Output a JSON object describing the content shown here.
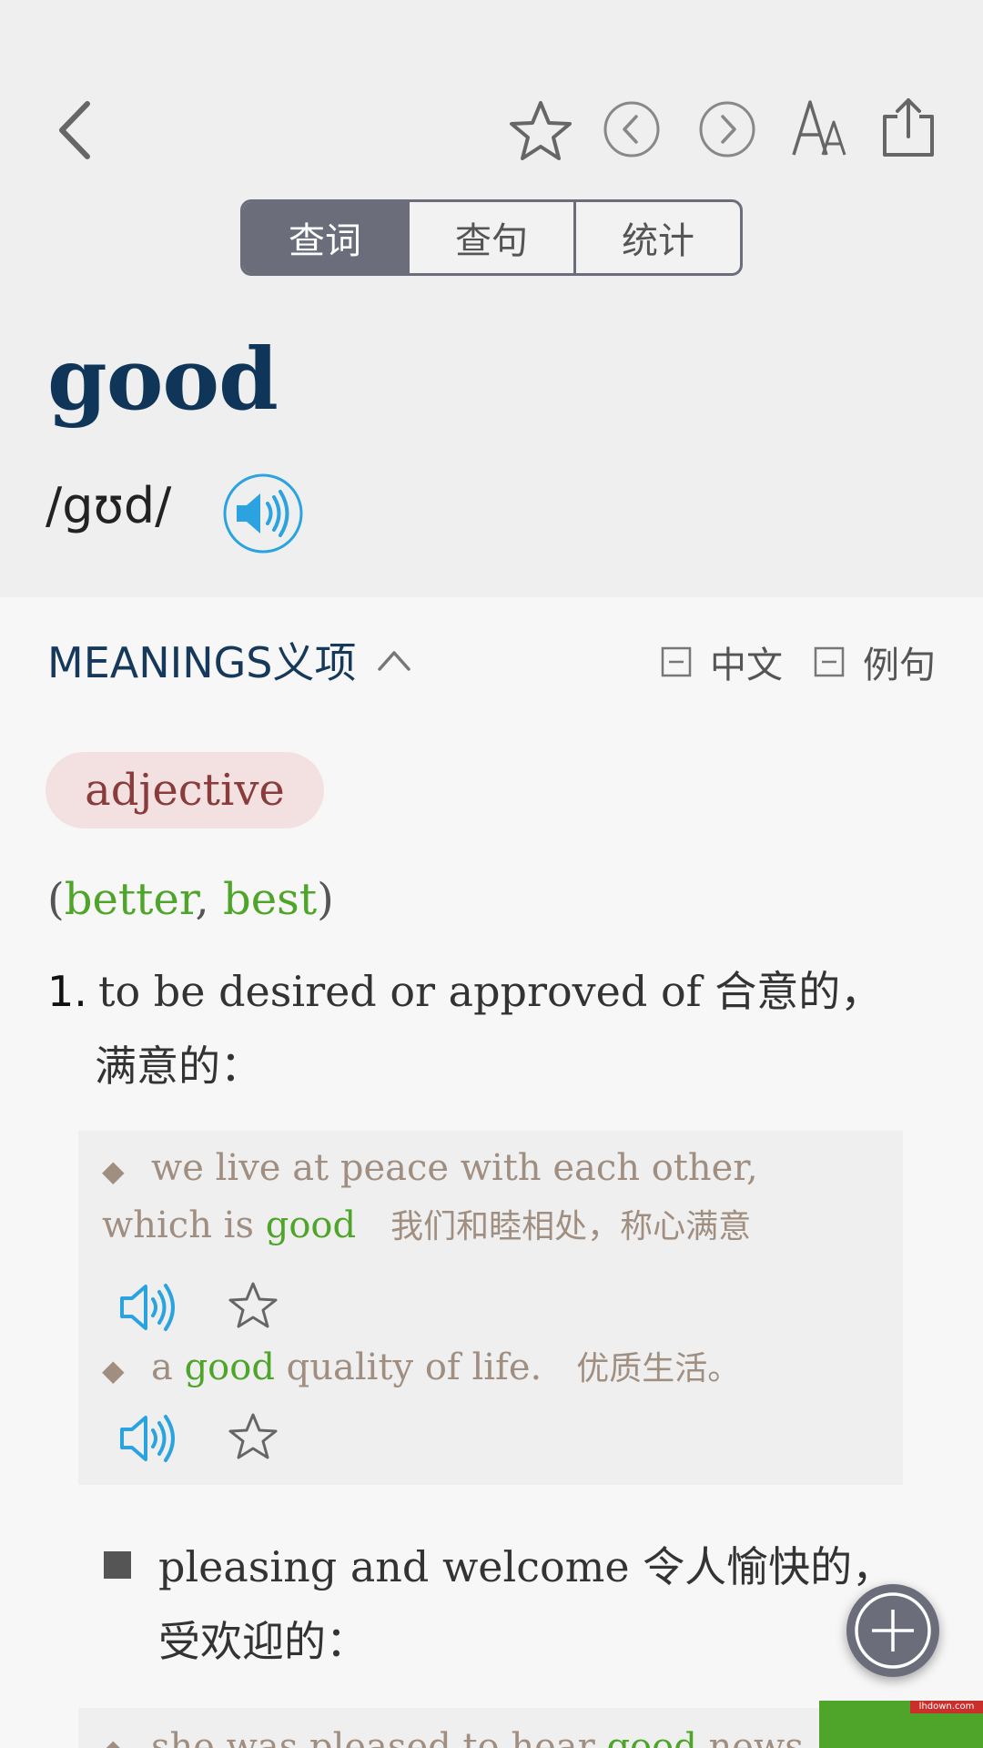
{
  "header": {
    "tabs": [
      {
        "label": "查词",
        "active": true
      },
      {
        "label": "查句",
        "active": false
      },
      {
        "label": "统计",
        "active": false
      }
    ],
    "icons": [
      "back-icon",
      "star-icon",
      "prev-icon",
      "next-icon",
      "font-size-icon",
      "share-icon"
    ]
  },
  "entry": {
    "headword": "good",
    "phonetic": "/gʊd/"
  },
  "meanings": {
    "title": "MEANINGS义项",
    "toggle_chinese": "中文",
    "toggle_examples": "例句"
  },
  "pos": "adjective",
  "forms": {
    "open": "(",
    "comparative": "better",
    "sep": ", ",
    "superlative": "best",
    "close": ")"
  },
  "sense1": {
    "number": "1.",
    "definition_en": "to be desired or approved of",
    "definition_cn_line1": "合意的，",
    "definition_cn_line2": "满意的："
  },
  "examples": [
    {
      "line1": "we live at peace with each other,",
      "line2_pre": "which is ",
      "line2_word": "good",
      "translation": "我们和睦相处，称心满意"
    },
    {
      "pre": "a ",
      "word": "good",
      "post": " quality of life.",
      "translation": "优质生活。"
    }
  ],
  "sub_sense": {
    "definition_en": "pleasing and welcome",
    "definition_cn_line1": "令人愉快的，",
    "definition_cn_line2": "受欢迎的："
  },
  "partial_example": {
    "pre": "she was pleased to hear ",
    "word": "good",
    "post": " news"
  },
  "watermark": "lhdown.com",
  "colors": {
    "accent_green": "#4ea52a",
    "headword_navy": "#0f3559",
    "segment_active": "#6b6e7a",
    "speaker_blue": "#2aa3e0"
  }
}
